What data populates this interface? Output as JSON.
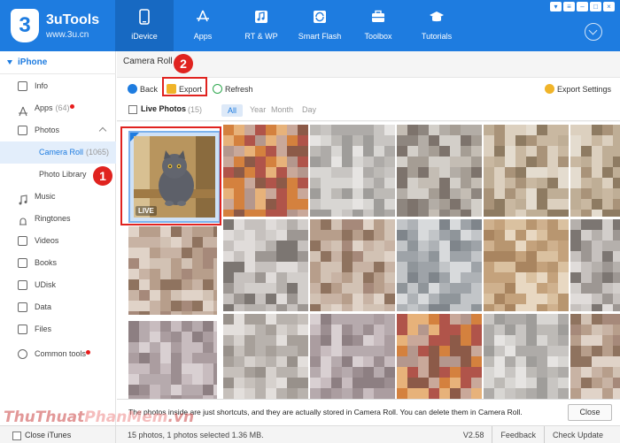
{
  "app": {
    "name": "3uTools",
    "site": "www.3u.cn",
    "logo_glyph": "3",
    "accent": "#1e7ce0"
  },
  "nav": [
    {
      "label": "iDevice",
      "icon": "phone-icon",
      "active": true
    },
    {
      "label": "Apps",
      "icon": "app-store-icon",
      "active": false
    },
    {
      "label": "RT & WP",
      "icon": "music-note-icon",
      "active": false
    },
    {
      "label": "Smart Flash",
      "icon": "refresh-box-icon",
      "active": false
    },
    {
      "label": "Toolbox",
      "icon": "toolbox-icon",
      "active": false
    },
    {
      "label": "Tutorials",
      "icon": "graduation-cap-icon",
      "active": false
    }
  ],
  "sidebar": {
    "device": "iPhone",
    "items": [
      {
        "label": "Info",
        "count": "",
        "sub": false
      },
      {
        "label": "Apps",
        "count": "(64)",
        "sub": false,
        "dot": true
      },
      {
        "label": "Photos",
        "count": "",
        "sub": false,
        "expanded": true
      },
      {
        "label": "Camera Roll",
        "count": "(1065)",
        "sub": true,
        "active": true
      },
      {
        "label": "Photo Library",
        "count": "",
        "sub": true
      },
      {
        "label": "Music",
        "count": "",
        "sub": false
      },
      {
        "label": "Ringtones",
        "count": "",
        "sub": false
      },
      {
        "label": "Videos",
        "count": "",
        "sub": false
      },
      {
        "label": "Books",
        "count": "",
        "sub": false
      },
      {
        "label": "UDisk",
        "count": "",
        "sub": false
      },
      {
        "label": "Data",
        "count": "",
        "sub": false
      },
      {
        "label": "Files",
        "count": "",
        "sub": false
      },
      {
        "label": "Common tools",
        "count": "",
        "sub": false,
        "dot": true
      }
    ],
    "close_itunes": "Close iTunes"
  },
  "main": {
    "title": "Camera Roll (10",
    "toolbar": {
      "back": "Back",
      "export": "Export",
      "refresh": "Refresh",
      "export_settings": "Export Settings"
    },
    "filter": {
      "live_photos": "Live Photos",
      "live_count": "(15)",
      "all": "All",
      "year": "Year",
      "month": "Month",
      "day": "Day"
    },
    "selected_badge": "LIVE",
    "notice": "The photos inside are just shortcuts, and they are actually stored in Camera Roll. You can delete them in Camera Roll.",
    "close": "Close"
  },
  "status": {
    "left": "15 photos, 1 photos selected 1.36 MB.",
    "version": "V2.58",
    "feedback": "Feedback",
    "check_update": "Check Update"
  },
  "annotations": {
    "step1": "1",
    "step2": "2",
    "color": "#e0231f"
  },
  "watermark": {
    "part1": "ThuThuat",
    "part2": "PhanMem",
    "part3": ".vn"
  }
}
